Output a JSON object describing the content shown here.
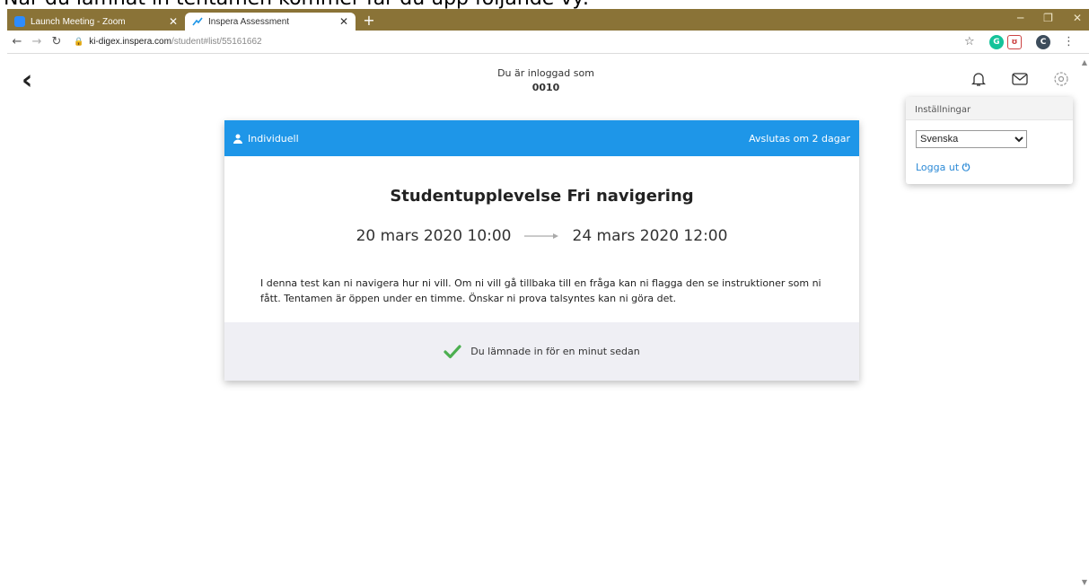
{
  "caption": {
    "text": "När du lämnat in tentamen kommer får du upp följande vy:"
  },
  "browser": {
    "tabs": [
      {
        "title": "Launch Meeting - Zoom",
        "icon": "zoom-icon",
        "active": false
      },
      {
        "title": "Inspera Assessment",
        "icon": "inspera-icon",
        "active": true
      }
    ],
    "url": {
      "host": "ki-digex.inspera.com",
      "path": "/student#list/55161662"
    },
    "profile_initial": "C"
  },
  "header": {
    "logged_in_label": "Du är inloggad som",
    "user_id": "0010"
  },
  "settings_menu": {
    "title": "Inställningar",
    "language_selected": "Svenska",
    "logout_label": "Logga ut"
  },
  "card": {
    "type_label": "Individuell",
    "ends_label": "Avslutas om 2 dagar",
    "title": "Studentupplevelse Fri navigering",
    "start": "20 mars 2020 10:00",
    "end": "24 mars 2020 12:00",
    "description": "I denna test kan ni navigera hur ni vill. Om ni vill gå tillbaka till en fråga kan ni flagga den se instruktioner som ni fått.  Tentamen är öppen under en timme. Önskar ni prova talsyntes kan ni göra det.",
    "status": "Du lämnade in för en minut sedan"
  },
  "colors": {
    "tabbar": "#8a7337",
    "card_header": "#1e96e8",
    "check": "#4caf50",
    "link": "#2c8ad6"
  }
}
